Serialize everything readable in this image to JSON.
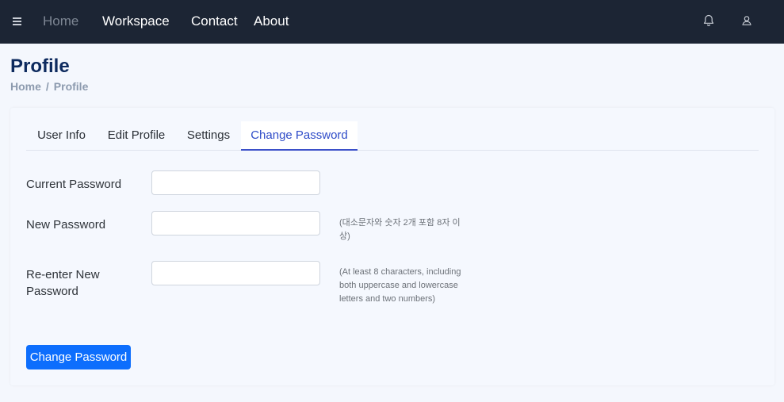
{
  "header": {
    "nav": [
      {
        "label": "Home"
      },
      {
        "label": "Workspace"
      },
      {
        "label": "Contact"
      },
      {
        "label": "About"
      }
    ],
    "icons": [
      "menu-icon",
      "bell-icon",
      "user-icon"
    ]
  },
  "page": {
    "title": "Profile",
    "breadcrumb": [
      "Home",
      "Profile"
    ],
    "breadcrumb_separator": "/"
  },
  "tabs": [
    {
      "label": "User Info",
      "active": false
    },
    {
      "label": "Edit Profile",
      "active": false
    },
    {
      "label": "Settings",
      "active": false
    },
    {
      "label": "Change Password",
      "active": true
    }
  ],
  "form": {
    "current_password": {
      "label": "Current Password",
      "value": ""
    },
    "new_password": {
      "label": "New Password",
      "value": "",
      "hint": "(대소문자와 숫자 2개 포함 8자 이상)"
    },
    "confirm_password": {
      "label": "Re-enter New Password",
      "value": "",
      "hint": "(At least 8 characters, including both uppercase and lowercase letters and two numbers)"
    },
    "submit_label": "Change Password"
  },
  "colors": {
    "topbar": "#1c2534",
    "accent": "#0d6efd",
    "active_tab": "#2f4cc8",
    "title": "#0d2a5e"
  }
}
